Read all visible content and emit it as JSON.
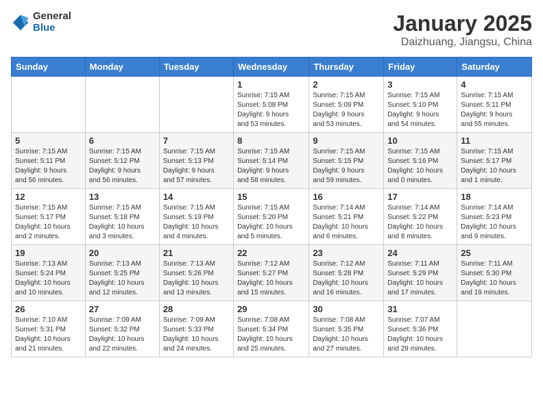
{
  "logo": {
    "general": "General",
    "blue": "Blue"
  },
  "header": {
    "title": "January 2025",
    "subtitle": "Daizhuang, Jiangsu, China"
  },
  "weekdays": [
    "Sunday",
    "Monday",
    "Tuesday",
    "Wednesday",
    "Thursday",
    "Friday",
    "Saturday"
  ],
  "weeks": [
    [
      {
        "day": "",
        "info": ""
      },
      {
        "day": "",
        "info": ""
      },
      {
        "day": "",
        "info": ""
      },
      {
        "day": "1",
        "info": "Sunrise: 7:15 AM\nSunset: 5:08 PM\nDaylight: 9 hours\nand 53 minutes."
      },
      {
        "day": "2",
        "info": "Sunrise: 7:15 AM\nSunset: 5:09 PM\nDaylight: 9 hours\nand 53 minutes."
      },
      {
        "day": "3",
        "info": "Sunrise: 7:15 AM\nSunset: 5:10 PM\nDaylight: 9 hours\nand 54 minutes."
      },
      {
        "day": "4",
        "info": "Sunrise: 7:15 AM\nSunset: 5:11 PM\nDaylight: 9 hours\nand 55 minutes."
      }
    ],
    [
      {
        "day": "5",
        "info": "Sunrise: 7:15 AM\nSunset: 5:11 PM\nDaylight: 9 hours\nand 56 minutes."
      },
      {
        "day": "6",
        "info": "Sunrise: 7:15 AM\nSunset: 5:12 PM\nDaylight: 9 hours\nand 56 minutes."
      },
      {
        "day": "7",
        "info": "Sunrise: 7:15 AM\nSunset: 5:13 PM\nDaylight: 9 hours\nand 57 minutes."
      },
      {
        "day": "8",
        "info": "Sunrise: 7:15 AM\nSunset: 5:14 PM\nDaylight: 9 hours\nand 58 minutes."
      },
      {
        "day": "9",
        "info": "Sunrise: 7:15 AM\nSunset: 5:15 PM\nDaylight: 9 hours\nand 59 minutes."
      },
      {
        "day": "10",
        "info": "Sunrise: 7:15 AM\nSunset: 5:16 PM\nDaylight: 10 hours\nand 0 minutes."
      },
      {
        "day": "11",
        "info": "Sunrise: 7:15 AM\nSunset: 5:17 PM\nDaylight: 10 hours\nand 1 minute."
      }
    ],
    [
      {
        "day": "12",
        "info": "Sunrise: 7:15 AM\nSunset: 5:17 PM\nDaylight: 10 hours\nand 2 minutes."
      },
      {
        "day": "13",
        "info": "Sunrise: 7:15 AM\nSunset: 5:18 PM\nDaylight: 10 hours\nand 3 minutes."
      },
      {
        "day": "14",
        "info": "Sunrise: 7:15 AM\nSunset: 5:19 PM\nDaylight: 10 hours\nand 4 minutes."
      },
      {
        "day": "15",
        "info": "Sunrise: 7:15 AM\nSunset: 5:20 PM\nDaylight: 10 hours\nand 5 minutes."
      },
      {
        "day": "16",
        "info": "Sunrise: 7:14 AM\nSunset: 5:21 PM\nDaylight: 10 hours\nand 6 minutes."
      },
      {
        "day": "17",
        "info": "Sunrise: 7:14 AM\nSunset: 5:22 PM\nDaylight: 10 hours\nand 8 minutes."
      },
      {
        "day": "18",
        "info": "Sunrise: 7:14 AM\nSunset: 5:23 PM\nDaylight: 10 hours\nand 9 minutes."
      }
    ],
    [
      {
        "day": "19",
        "info": "Sunrise: 7:13 AM\nSunset: 5:24 PM\nDaylight: 10 hours\nand 10 minutes."
      },
      {
        "day": "20",
        "info": "Sunrise: 7:13 AM\nSunset: 5:25 PM\nDaylight: 10 hours\nand 12 minutes."
      },
      {
        "day": "21",
        "info": "Sunrise: 7:13 AM\nSunset: 5:26 PM\nDaylight: 10 hours\nand 13 minutes."
      },
      {
        "day": "22",
        "info": "Sunrise: 7:12 AM\nSunset: 5:27 PM\nDaylight: 10 hours\nand 15 minutes."
      },
      {
        "day": "23",
        "info": "Sunrise: 7:12 AM\nSunset: 5:28 PM\nDaylight: 10 hours\nand 16 minutes."
      },
      {
        "day": "24",
        "info": "Sunrise: 7:11 AM\nSunset: 5:29 PM\nDaylight: 10 hours\nand 17 minutes."
      },
      {
        "day": "25",
        "info": "Sunrise: 7:11 AM\nSunset: 5:30 PM\nDaylight: 10 hours\nand 19 minutes."
      }
    ],
    [
      {
        "day": "26",
        "info": "Sunrise: 7:10 AM\nSunset: 5:31 PM\nDaylight: 10 hours\nand 21 minutes."
      },
      {
        "day": "27",
        "info": "Sunrise: 7:09 AM\nSunset: 5:32 PM\nDaylight: 10 hours\nand 22 minutes."
      },
      {
        "day": "28",
        "info": "Sunrise: 7:09 AM\nSunset: 5:33 PM\nDaylight: 10 hours\nand 24 minutes."
      },
      {
        "day": "29",
        "info": "Sunrise: 7:08 AM\nSunset: 5:34 PM\nDaylight: 10 hours\nand 25 minutes."
      },
      {
        "day": "30",
        "info": "Sunrise: 7:08 AM\nSunset: 5:35 PM\nDaylight: 10 hours\nand 27 minutes."
      },
      {
        "day": "31",
        "info": "Sunrise: 7:07 AM\nSunset: 5:36 PM\nDaylight: 10 hours\nand 29 minutes."
      },
      {
        "day": "",
        "info": ""
      }
    ]
  ]
}
